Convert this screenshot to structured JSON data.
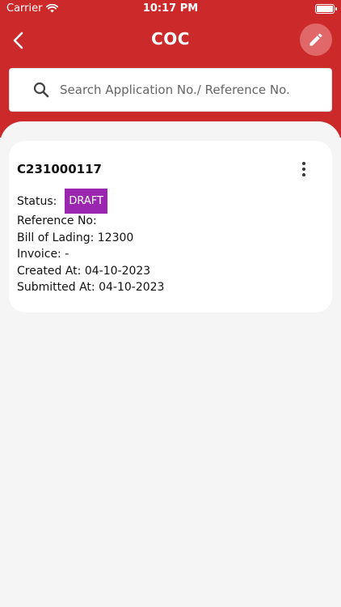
{
  "status_bar": {
    "carrier": "Carrier",
    "time": "10:17 PM"
  },
  "header": {
    "title": "COC"
  },
  "search": {
    "placeholder": "Search Application No./ Reference No."
  },
  "card": {
    "application_no": "C231000117",
    "status_label": "Status:",
    "status_value": "DRAFT",
    "status_color": "#9b27b0",
    "reference": "Reference No:",
    "bill_of_lading": "Bill of Lading: 12300",
    "invoice": "Invoice: -",
    "created_at": "Created At: 04-10-2023",
    "submitted_at": "Submitted At: 04-10-2023"
  },
  "colors": {
    "brand": "#cc2a2a",
    "edit_button": "#e06868"
  },
  "icons": [
    "wifi-icon",
    "battery-icon",
    "back-arrow-icon",
    "pencil-icon",
    "search-icon",
    "more-vertical-icon"
  ]
}
